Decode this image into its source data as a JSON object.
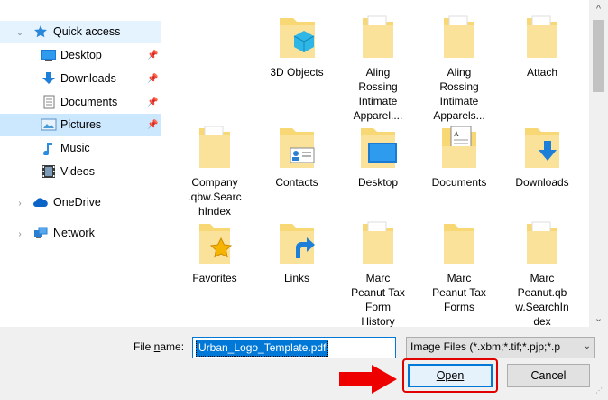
{
  "nav": {
    "quick_access": "Quick access",
    "items": [
      {
        "label": "Desktop",
        "icon": "desktop-icon",
        "pinned": true
      },
      {
        "label": "Downloads",
        "icon": "downloads-icon",
        "pinned": true
      },
      {
        "label": "Documents",
        "icon": "documents-icon",
        "pinned": true
      },
      {
        "label": "Pictures",
        "icon": "pictures-icon",
        "pinned": true
      },
      {
        "label": "Music",
        "icon": "music-icon",
        "pinned": false
      },
      {
        "label": "Videos",
        "icon": "videos-icon",
        "pinned": false
      }
    ],
    "onedrive": "OneDrive",
    "network": "Network"
  },
  "files": [
    {
      "label": "",
      "icon": "folder-icon"
    },
    {
      "label": "3D Objects",
      "icon": "3d-objects-folder-icon"
    },
    {
      "label": "Aling\nRossing\nIntimate\nApparel....",
      "icon": "folder-icon"
    },
    {
      "label": "Aling\nRossing\nIntimate\nApparels...",
      "icon": "folder-icon"
    },
    {
      "label": "Attach",
      "icon": "folder-icon"
    },
    {
      "label": "Company\n.qbw.Searc\nhIndex",
      "icon": "folder-icon"
    },
    {
      "label": "Contacts",
      "icon": "contacts-folder-icon"
    },
    {
      "label": "Desktop",
      "icon": "desktop-folder-icon"
    },
    {
      "label": "Documents",
      "icon": "documents-folder-icon"
    },
    {
      "label": "Downloads",
      "icon": "downloads-folder-icon"
    },
    {
      "label": "Favorites",
      "icon": "favorites-folder-icon"
    },
    {
      "label": "Links",
      "icon": "links-folder-icon"
    },
    {
      "label": "Marc\nPeanut Tax\nForm\nHistory",
      "icon": "folder-icon"
    },
    {
      "label": "Marc\nPeanut Tax\nForms",
      "icon": "folder-icon"
    },
    {
      "label": "Marc\nPeanut.qb\nw.SearchIn\ndex",
      "icon": "folder-icon"
    }
  ],
  "bottom": {
    "file_name_label_pre": "File ",
    "file_name_label_u": "n",
    "file_name_label_post": "ame:",
    "file_name_value": "Urban_Logo_Template.pdf",
    "file_type_value": "Image Files (*.xbm;*.tif;*.pjp;*.p",
    "open_label": "Open",
    "cancel_label": "Cancel"
  },
  "colors": {
    "accent": "#0078d7",
    "highlight_red": "#e00000",
    "folder_yellow": "#f8d775"
  }
}
